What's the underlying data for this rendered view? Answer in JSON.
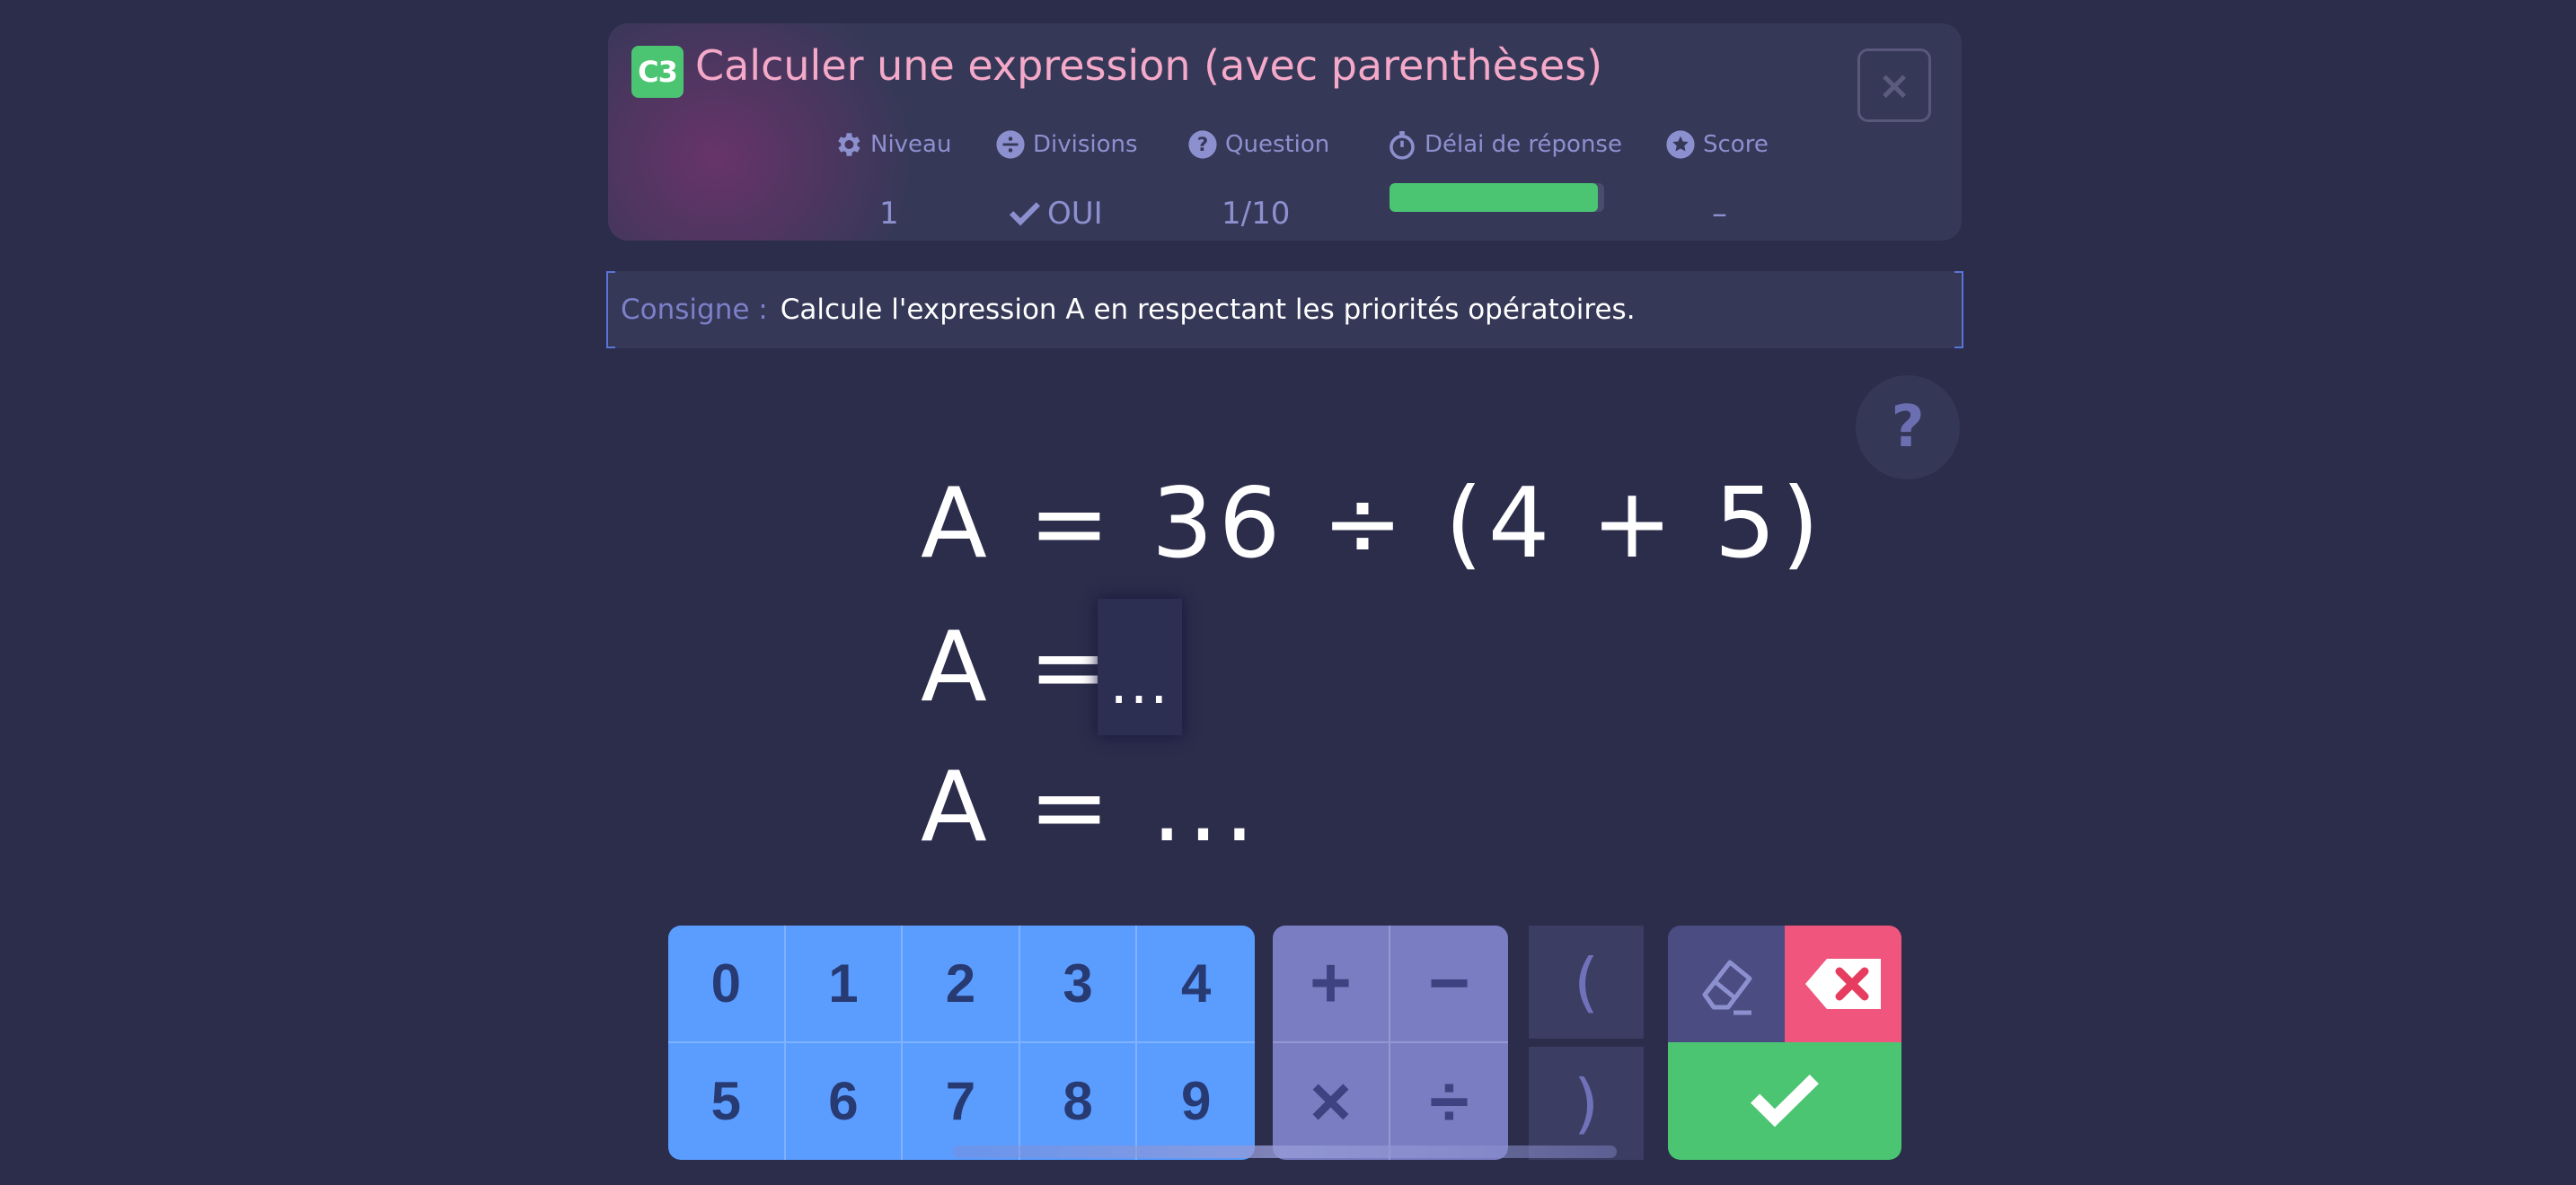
{
  "header": {
    "badge": "C3",
    "title": "Calculer une expression (avec parenthèses)",
    "close_label": "×",
    "stats": {
      "niveau": {
        "label": "Niveau",
        "value": "1"
      },
      "divisions": {
        "label": "Divisions",
        "value": "OUI"
      },
      "question": {
        "label": "Question",
        "value": "1/10"
      },
      "delai": {
        "label": "Délai de réponse",
        "progress": 0.97
      },
      "score": {
        "label": "Score",
        "value": "–"
      }
    }
  },
  "consigne": {
    "label": "Consigne :",
    "text": "Calcule l'expression A en respectant les priorités opératoires."
  },
  "help_label": "?",
  "expression": {
    "line1": "A = 36 ÷ (4 + 5)",
    "line2_prefix": "A =",
    "line2_input": "...",
    "line3": "A = ..."
  },
  "keypad": {
    "digits": [
      "0",
      "1",
      "2",
      "3",
      "4",
      "5",
      "6",
      "7",
      "8",
      "9"
    ],
    "operators": [
      "+",
      "−",
      "×",
      "÷"
    ],
    "parens": [
      "(",
      ")"
    ]
  },
  "colors": {
    "background": "#2b2d4b",
    "accent_green": "#4bc572",
    "accent_pink": "#f0557d",
    "digit_blue": "#5b9cff",
    "operator_purple": "#7a7dc2"
  }
}
